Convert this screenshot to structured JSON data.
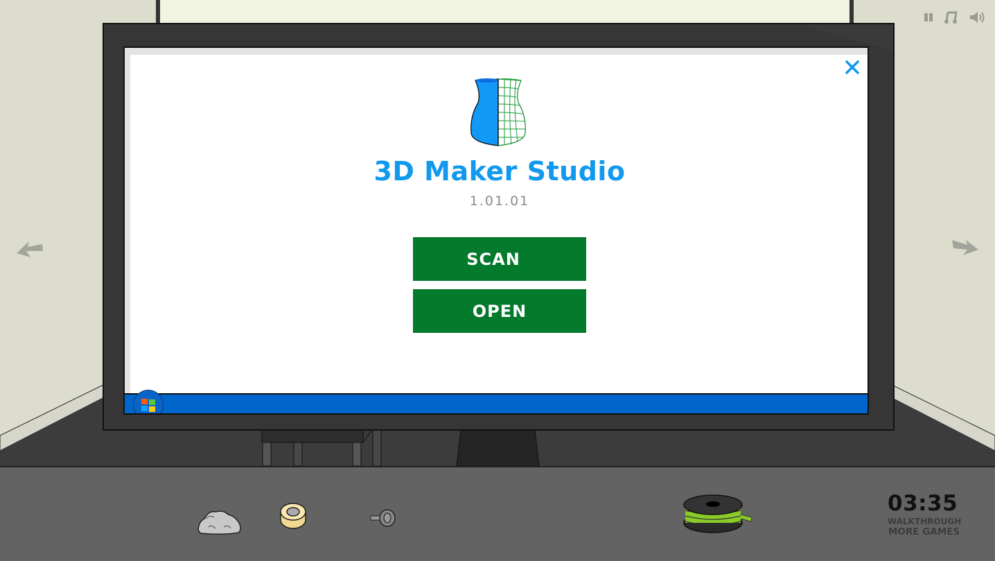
{
  "game": {
    "media_controls": [
      {
        "name": "pause",
        "icon": "pause-icon"
      },
      {
        "name": "music",
        "icon": "music-note-icon"
      },
      {
        "name": "sound",
        "icon": "speaker-icon"
      }
    ],
    "navigation": {
      "left": {
        "icon": "arrow-left-icon"
      },
      "right": {
        "icon": "arrow-right-icon"
      }
    },
    "inventory": [
      {
        "name": "rock",
        "icon": "rock-icon"
      },
      {
        "name": "tape-roll",
        "icon": "tape-roll-icon"
      },
      {
        "name": "key",
        "icon": "key-icon"
      },
      {
        "name": "filament-spool",
        "icon": "filament-spool-icon"
      }
    ],
    "timer": "03:35",
    "links": {
      "walkthrough": "WALKTHROUGH",
      "more_games": "MORE GAMES"
    }
  },
  "computer": {
    "app": {
      "title": "3D Maker Studio",
      "version": "1.01.01",
      "buttons": {
        "scan": "SCAN",
        "open": "OPEN"
      },
      "close_icon": "close-icon",
      "logo_icon": "vase-wireframe-logo"
    },
    "taskbar": {
      "start_icon": "windows-start-icon"
    }
  },
  "colors": {
    "title_blue": "#1199ee",
    "button_green": "#047a2c",
    "taskbar_blue": "#0066cc",
    "version_gray": "#8a8a8a"
  }
}
